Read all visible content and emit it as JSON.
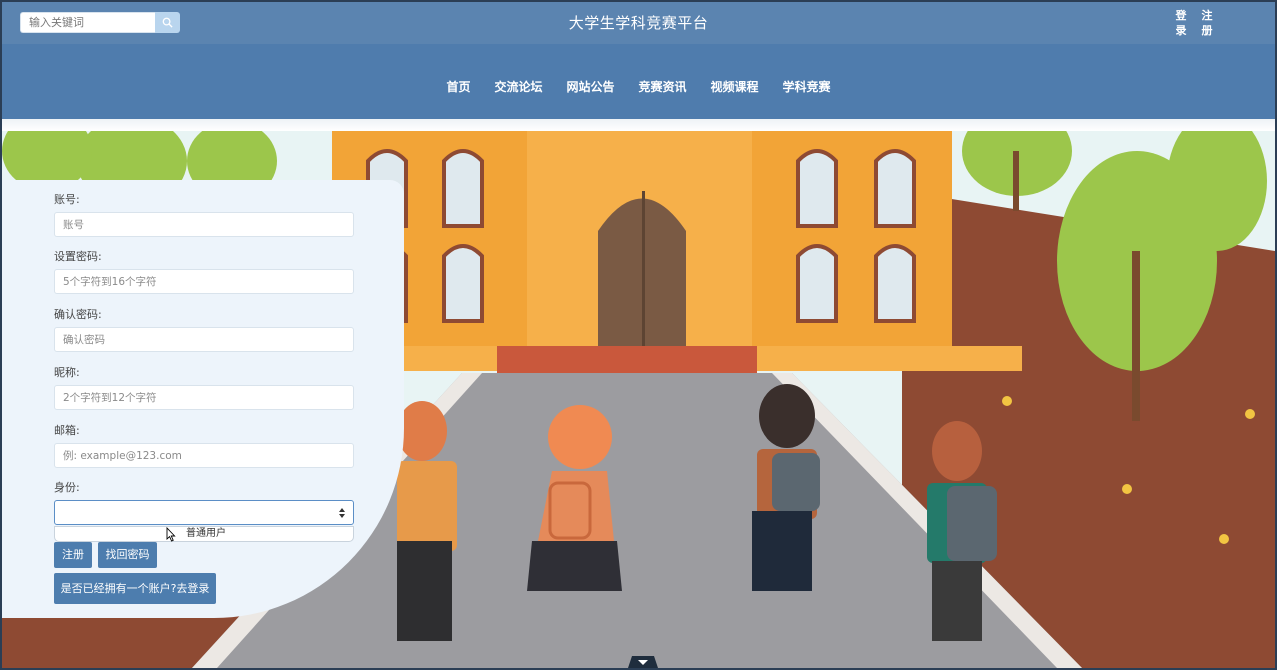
{
  "header": {
    "search_placeholder": "输入关键词",
    "site_title": "大学生学科竞赛平台",
    "login_chars": [
      "登",
      "录"
    ],
    "register_chars": [
      "注",
      "册"
    ]
  },
  "nav": {
    "items": [
      "首页",
      "交流论坛",
      "网站公告",
      "竞赛资讯",
      "视频课程",
      "学科竞赛"
    ]
  },
  "form": {
    "account": {
      "label": "账号:",
      "placeholder": "账号"
    },
    "password": {
      "label": "设置密码:",
      "placeholder": "5个字符到16个字符"
    },
    "confirm": {
      "label": "确认密码:",
      "placeholder": "确认密码"
    },
    "nickname": {
      "label": "昵称:",
      "placeholder": "2个字符到12个字符"
    },
    "email": {
      "label": "邮箱:",
      "placeholder": "例: example@123.com"
    },
    "role": {
      "label": "身份:",
      "value": "",
      "options": [
        "普通用户"
      ]
    },
    "register_button": "注册",
    "recover_button": "找回密码",
    "login_link_button": "是否已经拥有一个账户?去登录"
  },
  "colors": {
    "topbar": "#5b84b0",
    "nav": "#4f7cad",
    "button": "#4d7dae",
    "panel": "#edf4fb"
  }
}
